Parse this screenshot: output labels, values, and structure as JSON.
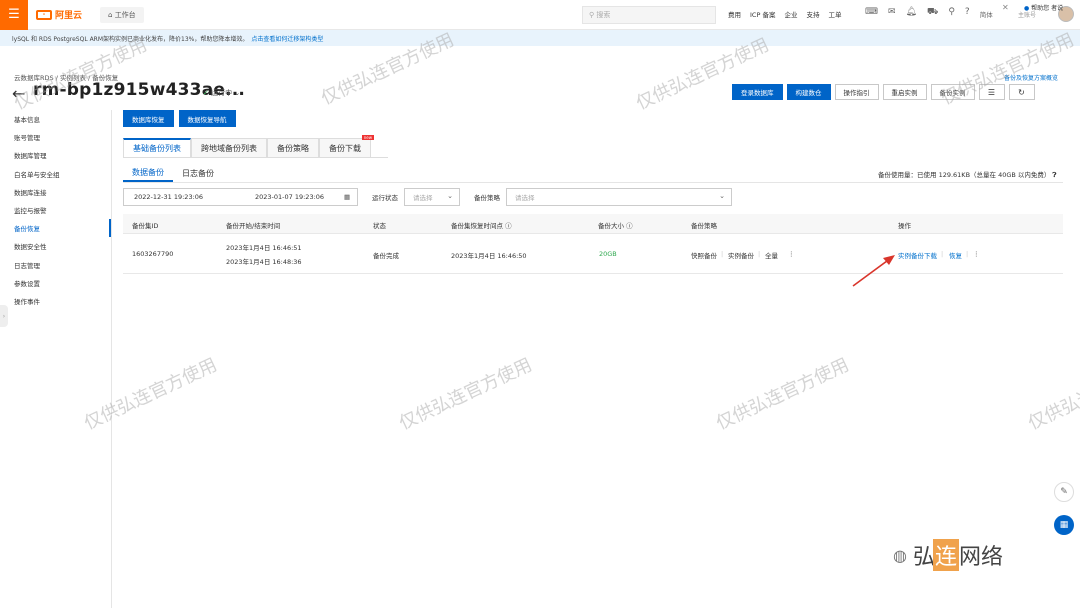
{
  "topbar": {
    "logo_text": "阿里云",
    "workbench": "工作台",
    "search_placeholder": "搜索",
    "links": [
      "费用",
      "ICP 备案",
      "企业",
      "支持",
      "工单"
    ],
    "lang": "简体",
    "user": "主账号"
  },
  "notice": {
    "text": "lySQL 和 RDS PostgreSQL ARM架构实例已商业化发布，降价13%，帮助您降本增效。",
    "link": "点击查看如何迁移架构类型",
    "right": "帮助您\n者说"
  },
  "header": {
    "breadcrumb": "云数据库RDS / 实例列表 / 备份恢复",
    "title": "rm-bp1z915w433ae...",
    "status": "运行中",
    "top_right_link": "备份及恢复方案概览",
    "actions": [
      "登录数据库",
      "构建数仓",
      "操作指引",
      "重启实例",
      "备份实例"
    ]
  },
  "sidebar": {
    "items": [
      "基本信息",
      "账号管理",
      "数据库管理",
      "白名单与安全组",
      "数据库连接",
      "监控与报警",
      "备份恢复",
      "数据安全性",
      "日志管理",
      "参数设置",
      "操作事件"
    ],
    "active_index": 6
  },
  "content": {
    "actions": [
      "数据库恢复",
      "数据恢复导航"
    ],
    "tabs": [
      "基础备份列表",
      "跨地域备份列表",
      "备份策略",
      "备份下载"
    ],
    "new_badge": "new",
    "subtabs": [
      "数据备份",
      "日志备份"
    ],
    "usage": "备份使用量：已使用 129.61KB（总量在 40GB 以内免费）",
    "filters": {
      "start": "2022-12-31 19:23:06",
      "end": "2023-01-07 19:23:06",
      "status_label": "运行状态",
      "status_placeholder": "请选择",
      "strategy_label": "备份策略",
      "strategy_placeholder": "请选择"
    },
    "columns": [
      "备份集ID",
      "备份开始/结束时间",
      "状态",
      "备份集恢复时间点",
      "备份大小",
      "备份策略",
      "操作"
    ],
    "rows": [
      {
        "id": "1603267790",
        "start": "2023年1月4日 16:46:51",
        "end": "2023年1月4日 16:48:36",
        "status": "备份完成",
        "restore_point": "2023年1月4日 16:46:50",
        "size": "20GB",
        "strategy": [
          "快照备份",
          "实例备份",
          "全量"
        ],
        "ops": [
          "实例备份下载",
          "恢复"
        ]
      }
    ]
  },
  "watermark": "仅供弘连官方使用",
  "brand": {
    "prefix": "弘",
    "hl": "连",
    "suffix": "网络"
  },
  "colors": {
    "orange": "#ff6a00",
    "primary": "#0064c8",
    "green": "#2fa84f",
    "arrow": "#d9352b"
  }
}
